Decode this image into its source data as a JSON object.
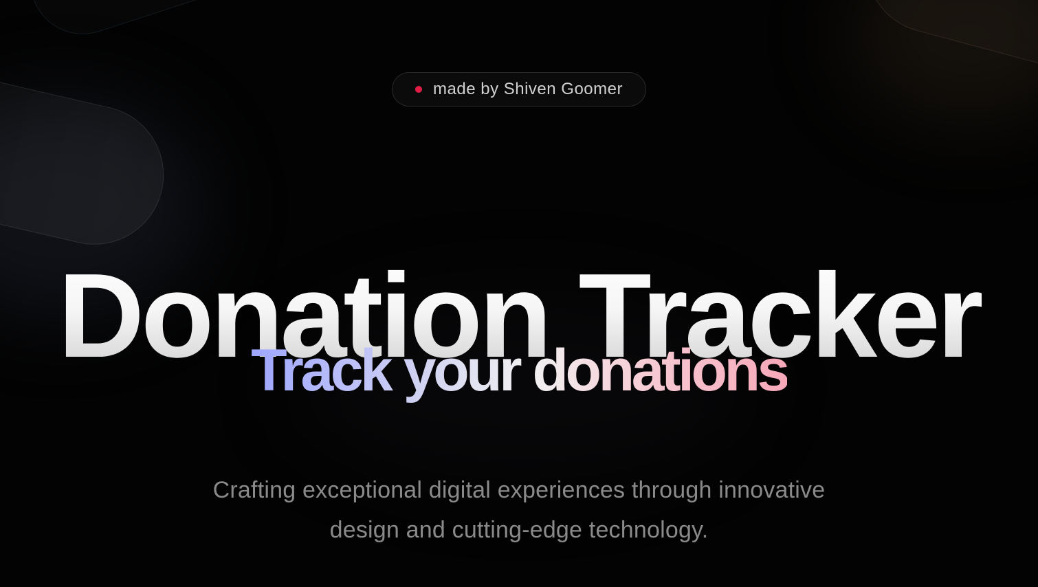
{
  "hero": {
    "badge": {
      "text": "made by Shiven Goomer",
      "dot_color": "#e11d48"
    },
    "title": "Donation Tracker",
    "subtitle": "Track your donations",
    "description": "Crafting exceptional digital experiences through innovative design and cutting-edge technology."
  },
  "colors": {
    "background": "#030303",
    "title_gradient_top": "#ffffff",
    "title_gradient_bottom": "#cccccc",
    "subtitle_gradient": [
      "#9ea6ff",
      "#d5d6f1",
      "#f2f2f2",
      "#f6c6d0",
      "#f7a8b8"
    ],
    "description_text": "#8a8a8a"
  }
}
